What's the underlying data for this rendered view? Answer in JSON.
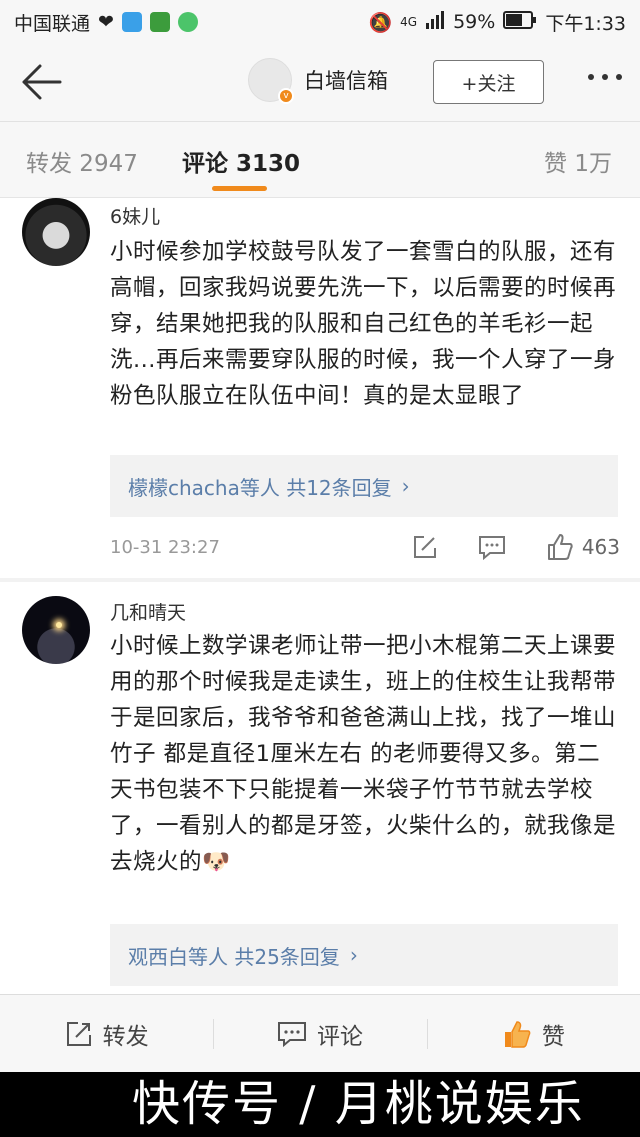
{
  "status_bar": {
    "carrier": "中国联通",
    "network": "4G",
    "battery": "59%",
    "time": "下午1:33"
  },
  "nav": {
    "username": "白墙信箱",
    "follow_label": "+关注"
  },
  "tabs": {
    "repost": "转发 2947",
    "comment": "评论 3130",
    "like": "赞 1万"
  },
  "comments": [
    {
      "name": "6妹儿",
      "text": "小时候参加学校鼓号队发了一套雪白的队服，还有高帽，回家我妈说要先洗一下，以后需要的时候再穿，结果她把我的队服和自己红色的羊毛衫一起洗...再后来需要穿队服的时候，我一个人穿了一身粉色队服立在队伍中间！真的是太显眼了",
      "replies": "檬檬chacha等人 共12条回复",
      "time": "10-31 23:27",
      "likes": "463"
    },
    {
      "name": "几和晴天",
      "text": "小时候上数学课老师让带一把小木棍第二天上课要用的那个时候我是走读生，班上的住校生让我帮带于是回家后，我爷爷和爸爸满山上找，找了一堆山竹子 都是直径1厘米左右 的老师要得又多。第二天书包装不下只能提着一米袋子竹节节就去学校了，一看别人的都是牙签，火柴什么的，就我像是去烧火的🐶",
      "replies": "观西白等人 共25条回复"
    }
  ],
  "bottom_bar": {
    "repost": "转发",
    "comment": "评论",
    "like": "赞"
  },
  "watermark": "快传号 / 月桃说娱乐",
  "colors": {
    "accent": "#f08a1c",
    "link": "#5b7ea9"
  }
}
